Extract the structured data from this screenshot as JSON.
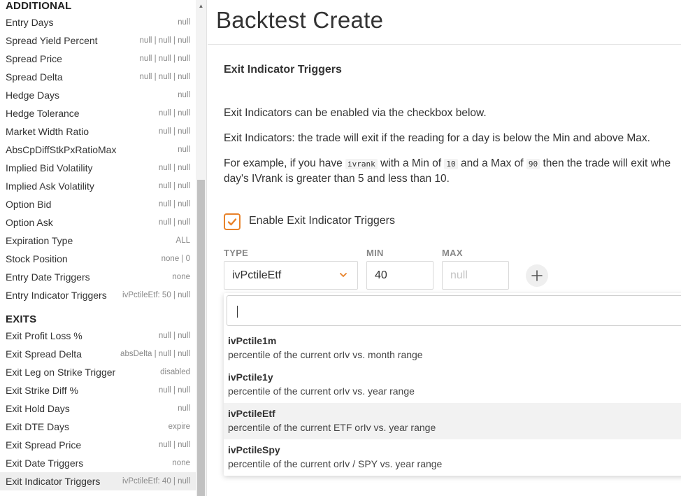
{
  "sidebar": {
    "sections": [
      {
        "title": "ADDITIONAL",
        "rows": [
          {
            "label": "Entry Days",
            "value": "null"
          },
          {
            "label": "Spread Yield Percent",
            "value": "null | null | null"
          },
          {
            "label": "Spread Price",
            "value": "null | null | null"
          },
          {
            "label": "Spread Delta",
            "value": "null | null | null"
          },
          {
            "label": "Hedge Days",
            "value": "null"
          },
          {
            "label": "Hedge Tolerance",
            "value": "null | null"
          },
          {
            "label": "Market Width Ratio",
            "value": "null | null"
          },
          {
            "label": "AbsCpDiffStkPxRatioMax",
            "value": "null"
          },
          {
            "label": "Implied Bid Volatility",
            "value": "null | null"
          },
          {
            "label": "Implied Ask Volatility",
            "value": "null | null"
          },
          {
            "label": "Option Bid",
            "value": "null | null"
          },
          {
            "label": "Option Ask",
            "value": "null | null"
          },
          {
            "label": "Expiration Type",
            "value": "ALL"
          },
          {
            "label": "Stock Position",
            "value": "none | 0"
          },
          {
            "label": "Entry Date Triggers",
            "value": "none"
          },
          {
            "label": "Entry Indicator Triggers",
            "value": "ivPctileEtf: 50 | null"
          }
        ]
      },
      {
        "title": "EXITS",
        "rows": [
          {
            "label": "Exit Profit Loss %",
            "value": "null | null"
          },
          {
            "label": "Exit Spread Delta",
            "value": "absDelta | null | null"
          },
          {
            "label": "Exit Leg on Strike Trigger",
            "value": "disabled"
          },
          {
            "label": "Exit Strike Diff %",
            "value": "null | null"
          },
          {
            "label": "Exit Hold Days",
            "value": "null"
          },
          {
            "label": "Exit DTE Days",
            "value": "expire"
          },
          {
            "label": "Exit Spread Price",
            "value": "null | null"
          },
          {
            "label": "Exit Date Triggers",
            "value": "none"
          },
          {
            "label": "Exit Indicator Triggers",
            "value": "ivPctileEtf: 40 | null"
          }
        ]
      }
    ]
  },
  "main": {
    "page_title": "Backtest Create",
    "section_title": "Exit Indicator Triggers",
    "para1": "Exit Indicators can be enabled via the checkbox below.",
    "para2": "Exit Indicators: the trade will exit if the reading for a day is below the Min and above Max.",
    "para3": {
      "t1": "For example, if you have ",
      "c1": "ivrank",
      "t2": " with a Min of ",
      "c2": "10",
      "t3": " and a Max of ",
      "c3": "90",
      "t4": " then the trade will exit whe",
      "line2": "day's IVrank is greater than 5 and less than 10."
    },
    "enable_label": "Enable Exit Indicator Triggers",
    "enable_checked": true,
    "accent_color": "#e8822a",
    "columns": {
      "type": "TYPE",
      "min": "MIN",
      "max": "MAX"
    },
    "type_value": "ivPctileEtf",
    "min_value": "40",
    "max_placeholder": "null",
    "dropdown": {
      "search_value": "",
      "options": [
        {
          "name": "ivPctile1m",
          "desc": "percentile of the current orIv vs. month range",
          "active": false
        },
        {
          "name": "ivPctile1y",
          "desc": "percentile of the current orIv vs. year range",
          "active": false
        },
        {
          "name": "ivPctileEtf",
          "desc": "percentile of the current ETF orIv vs. year range",
          "active": true
        },
        {
          "name": "ivPctileSpy",
          "desc": "percentile of the current orIv / SPY vs. year range",
          "active": false
        }
      ]
    }
  },
  "icons": {
    "check": "check-icon",
    "chevron": "chevron-down-icon",
    "add": "plus-icon",
    "scroll_up": "triangle-up-icon"
  }
}
